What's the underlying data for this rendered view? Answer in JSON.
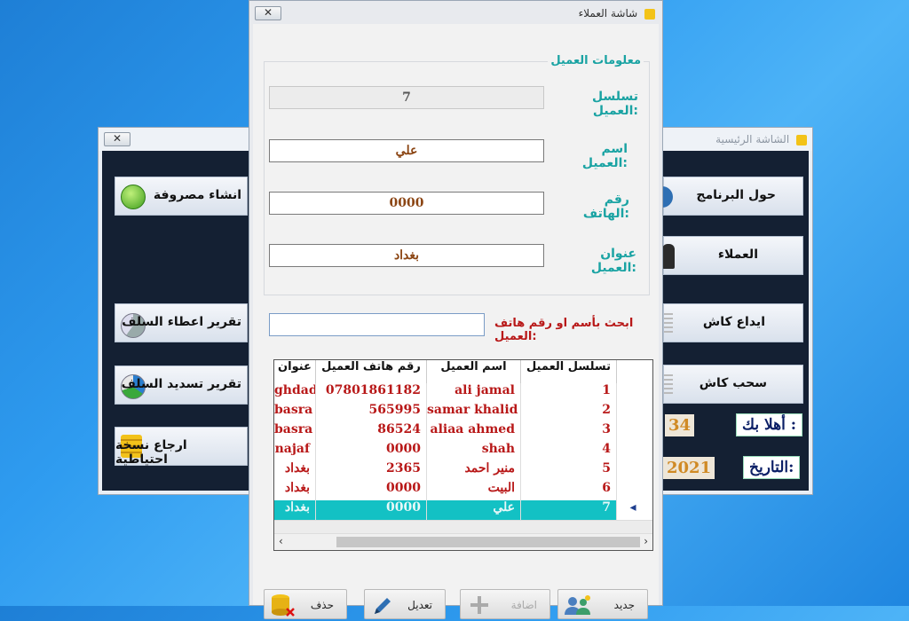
{
  "main_window": {
    "title": "الشاشة الرئيسية",
    "close": "✕",
    "buttons": {
      "about": "حول البرنامج",
      "customers": "العملاء",
      "deposit": "ايداع كاش",
      "withdraw": "سحب كاش",
      "create_expense": "انشاء مصروفة",
      "loan_report": "تقرير اعطاء السلف",
      "repay_report": "تقرير تسديد السلف",
      "restore_backup": "ارجاع نسخة احتياطية"
    },
    "welcome_label": "أهلا بك :",
    "welcome_value": "34",
    "date_label": "التاريخ:",
    "date_value": "2021"
  },
  "customer_window": {
    "title": "شاشة العملاء",
    "close": "✕",
    "group_title": "معلومات العميل",
    "fields": {
      "serial_label": "تسلسل العميل:",
      "serial_value": "7",
      "name_label": "اسم العميل:",
      "name_value": "علي",
      "phone_label": "رقم الهاتف:",
      "phone_value": "0000",
      "address_label": "عنوان العميل:",
      "address_value": "بغداد"
    },
    "search_label": "ابحث بأسم او رقم هاتف العميل:",
    "search_value": "",
    "grid": {
      "headers": [
        "تسلسل العميل",
        "اسم العميل",
        "رقم هاتف العميل",
        "عنوان"
      ],
      "rows": [
        [
          "1",
          "ali jamal",
          "07801861182",
          "ghdad"
        ],
        [
          "2",
          "samar khalid",
          "565995",
          "basra"
        ],
        [
          "3",
          "aliaa ahmed",
          "86524",
          "basra"
        ],
        [
          "4",
          "shah",
          "0000",
          "najaf"
        ],
        [
          "5",
          "منير احمد",
          "2365",
          "بغداد"
        ],
        [
          "6",
          "البيت",
          "0000",
          "بغداد"
        ],
        [
          "7",
          "علي",
          "0000",
          "بغداد"
        ]
      ],
      "selected_row": 7,
      "selected_color": "#13c1c4"
    },
    "actions": {
      "new": "جديد",
      "add": "اضافة",
      "edit": "تعديل",
      "delete": "حذف"
    }
  },
  "colors": {
    "accent_teal": "#1aa3a3",
    "value_red": "#b81818",
    "desktop_blue": "#2f9cf0"
  }
}
